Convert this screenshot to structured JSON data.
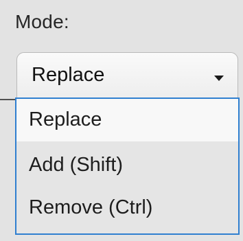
{
  "mode_label": "Mode:",
  "select": {
    "value": "Replace"
  },
  "dropdown": {
    "options": [
      "Replace",
      "Add (Shift)",
      "Remove (Ctrl)"
    ],
    "selected": "Replace"
  },
  "icons": {
    "caret": "chevron-down-icon"
  },
  "colors": {
    "focus_border": "#2f7fd0"
  }
}
